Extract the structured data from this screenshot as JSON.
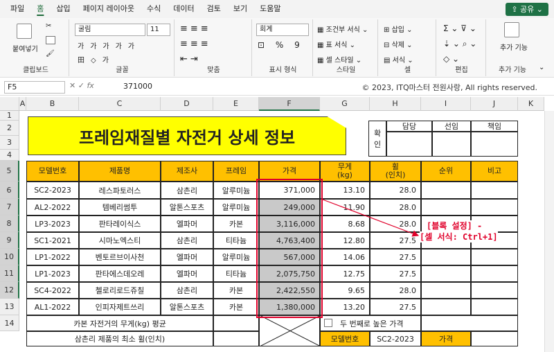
{
  "tabs": [
    "파일",
    "홈",
    "삽입",
    "페이지 레이아웃",
    "수식",
    "데이터",
    "검토",
    "보기",
    "도움말"
  ],
  "share_label": "공유",
  "ribbon": {
    "paste": "붙여넣기",
    "clipboard": "클립보드",
    "font_name": "굴림",
    "font_size": "11",
    "font_group": "글꼴",
    "align_group": "맞춤",
    "num_format": "회계",
    "num_group": "표시 형식",
    "cond": "조건부 서식",
    "table": "표 서식",
    "cellstyle": "셀 스타일",
    "style_group": "스타일",
    "insert": "삽입",
    "delete": "삭제",
    "format": "서식",
    "cells_group": "셀",
    "edit_group": "편집",
    "addins": "추가 기능",
    "addins_group": "추가 기능"
  },
  "formula": {
    "namebox": "F5",
    "fx": "fx",
    "value": "371000",
    "copyright": "© 2023, ITQ마스터 전원사랑, All rights reserved."
  },
  "columns": [
    "A",
    "B",
    "C",
    "D",
    "E",
    "F",
    "G",
    "H",
    "I",
    "J",
    "K"
  ],
  "rows": [
    "1",
    "2",
    "3",
    "4",
    "5",
    "6",
    "7",
    "8",
    "9",
    "10",
    "11",
    "12",
    "13",
    "14"
  ],
  "title": "프레임재질별 자전거 상세 정보",
  "approval": {
    "label1": "확",
    "label2": "인",
    "headers": [
      "담당",
      "선임",
      "책임"
    ]
  },
  "table_headers": [
    "모델번호",
    "제품명",
    "제조사",
    "프레임",
    "가격",
    "무게\n(kg)",
    "휠\n(인치)",
    "순위",
    "비고"
  ],
  "table_rows": [
    [
      "SC2-2023",
      "레스파토러스",
      "삼촌리",
      "알루미늄",
      "371,000",
      "13.10",
      "28.0",
      "",
      ""
    ],
    [
      "AL2-2022",
      "템베리썸투",
      "알톤스포츠",
      "알루미늄",
      "249,000",
      "11.90",
      "28.0",
      "",
      ""
    ],
    [
      "LP3-2023",
      "판타레이식스",
      "엘파머",
      "카본",
      "3,116,000",
      "8.68",
      "28.0",
      "",
      ""
    ],
    [
      "SC1-2021",
      "시마노엑스티",
      "삼촌리",
      "티타늄",
      "4,763,400",
      "12.80",
      "27.5",
      "",
      ""
    ],
    [
      "LP1-2022",
      "벤토르브이사천",
      "엘파머",
      "알루미늄",
      "567,000",
      "14.06",
      "27.5",
      "",
      ""
    ],
    [
      "LP1-2023",
      "판타에스데오레",
      "엘파머",
      "티타늄",
      "2,075,750",
      "12.75",
      "27.5",
      "",
      ""
    ],
    [
      "SC4-2022",
      "첼로리로드쥬칠",
      "삼촌리",
      "카본",
      "2,422,550",
      "9.65",
      "28.0",
      "",
      ""
    ],
    [
      "AL1-2022",
      "인피자제트쓰리",
      "알톤스포츠",
      "카본",
      "1,380,000",
      "13.20",
      "27.5",
      "",
      ""
    ]
  ],
  "row13_label": "카본 자전거의 무게(kg) 평균",
  "row14_label": "삼촌리 제품의 최소 휠(인치)",
  "second_price": "두 번째로 높은 가격",
  "model_label": "모델번호",
  "model_value": "SC2-2023",
  "price_label": "가격",
  "annotation1": "[블록 설정] -",
  "annotation2": "[셀 서식: Ctrl+1]",
  "colors": {
    "header": "#ffc000",
    "title": "#ffff00",
    "annot": "#e0002a",
    "excel_green": "#1e7145"
  }
}
